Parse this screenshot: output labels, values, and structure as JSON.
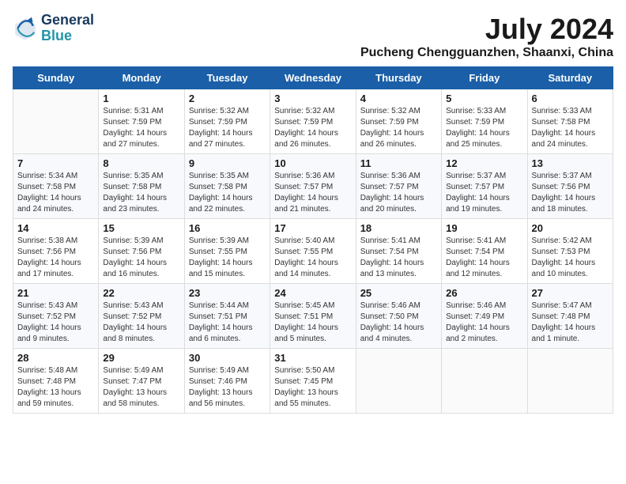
{
  "logo": {
    "line1": "General",
    "line2": "Blue"
  },
  "header": {
    "month_year": "July 2024",
    "location": "Pucheng Chengguanzhen, Shaanxi, China"
  },
  "weekdays": [
    "Sunday",
    "Monday",
    "Tuesday",
    "Wednesday",
    "Thursday",
    "Friday",
    "Saturday"
  ],
  "weeks": [
    [
      {
        "day": "",
        "sunrise": "",
        "sunset": "",
        "daylight": ""
      },
      {
        "day": "1",
        "sunrise": "Sunrise: 5:31 AM",
        "sunset": "Sunset: 7:59 PM",
        "daylight": "Daylight: 14 hours and 27 minutes."
      },
      {
        "day": "2",
        "sunrise": "Sunrise: 5:32 AM",
        "sunset": "Sunset: 7:59 PM",
        "daylight": "Daylight: 14 hours and 27 minutes."
      },
      {
        "day": "3",
        "sunrise": "Sunrise: 5:32 AM",
        "sunset": "Sunset: 7:59 PM",
        "daylight": "Daylight: 14 hours and 26 minutes."
      },
      {
        "day": "4",
        "sunrise": "Sunrise: 5:32 AM",
        "sunset": "Sunset: 7:59 PM",
        "daylight": "Daylight: 14 hours and 26 minutes."
      },
      {
        "day": "5",
        "sunrise": "Sunrise: 5:33 AM",
        "sunset": "Sunset: 7:59 PM",
        "daylight": "Daylight: 14 hours and 25 minutes."
      },
      {
        "day": "6",
        "sunrise": "Sunrise: 5:33 AM",
        "sunset": "Sunset: 7:58 PM",
        "daylight": "Daylight: 14 hours and 24 minutes."
      }
    ],
    [
      {
        "day": "7",
        "sunrise": "Sunrise: 5:34 AM",
        "sunset": "Sunset: 7:58 PM",
        "daylight": "Daylight: 14 hours and 24 minutes."
      },
      {
        "day": "8",
        "sunrise": "Sunrise: 5:35 AM",
        "sunset": "Sunset: 7:58 PM",
        "daylight": "Daylight: 14 hours and 23 minutes."
      },
      {
        "day": "9",
        "sunrise": "Sunrise: 5:35 AM",
        "sunset": "Sunset: 7:58 PM",
        "daylight": "Daylight: 14 hours and 22 minutes."
      },
      {
        "day": "10",
        "sunrise": "Sunrise: 5:36 AM",
        "sunset": "Sunset: 7:57 PM",
        "daylight": "Daylight: 14 hours and 21 minutes."
      },
      {
        "day": "11",
        "sunrise": "Sunrise: 5:36 AM",
        "sunset": "Sunset: 7:57 PM",
        "daylight": "Daylight: 14 hours and 20 minutes."
      },
      {
        "day": "12",
        "sunrise": "Sunrise: 5:37 AM",
        "sunset": "Sunset: 7:57 PM",
        "daylight": "Daylight: 14 hours and 19 minutes."
      },
      {
        "day": "13",
        "sunrise": "Sunrise: 5:37 AM",
        "sunset": "Sunset: 7:56 PM",
        "daylight": "Daylight: 14 hours and 18 minutes."
      }
    ],
    [
      {
        "day": "14",
        "sunrise": "Sunrise: 5:38 AM",
        "sunset": "Sunset: 7:56 PM",
        "daylight": "Daylight: 14 hours and 17 minutes."
      },
      {
        "day": "15",
        "sunrise": "Sunrise: 5:39 AM",
        "sunset": "Sunset: 7:56 PM",
        "daylight": "Daylight: 14 hours and 16 minutes."
      },
      {
        "day": "16",
        "sunrise": "Sunrise: 5:39 AM",
        "sunset": "Sunset: 7:55 PM",
        "daylight": "Daylight: 14 hours and 15 minutes."
      },
      {
        "day": "17",
        "sunrise": "Sunrise: 5:40 AM",
        "sunset": "Sunset: 7:55 PM",
        "daylight": "Daylight: 14 hours and 14 minutes."
      },
      {
        "day": "18",
        "sunrise": "Sunrise: 5:41 AM",
        "sunset": "Sunset: 7:54 PM",
        "daylight": "Daylight: 14 hours and 13 minutes."
      },
      {
        "day": "19",
        "sunrise": "Sunrise: 5:41 AM",
        "sunset": "Sunset: 7:54 PM",
        "daylight": "Daylight: 14 hours and 12 minutes."
      },
      {
        "day": "20",
        "sunrise": "Sunrise: 5:42 AM",
        "sunset": "Sunset: 7:53 PM",
        "daylight": "Daylight: 14 hours and 10 minutes."
      }
    ],
    [
      {
        "day": "21",
        "sunrise": "Sunrise: 5:43 AM",
        "sunset": "Sunset: 7:52 PM",
        "daylight": "Daylight: 14 hours and 9 minutes."
      },
      {
        "day": "22",
        "sunrise": "Sunrise: 5:43 AM",
        "sunset": "Sunset: 7:52 PM",
        "daylight": "Daylight: 14 hours and 8 minutes."
      },
      {
        "day": "23",
        "sunrise": "Sunrise: 5:44 AM",
        "sunset": "Sunset: 7:51 PM",
        "daylight": "Daylight: 14 hours and 6 minutes."
      },
      {
        "day": "24",
        "sunrise": "Sunrise: 5:45 AM",
        "sunset": "Sunset: 7:51 PM",
        "daylight": "Daylight: 14 hours and 5 minutes."
      },
      {
        "day": "25",
        "sunrise": "Sunrise: 5:46 AM",
        "sunset": "Sunset: 7:50 PM",
        "daylight": "Daylight: 14 hours and 4 minutes."
      },
      {
        "day": "26",
        "sunrise": "Sunrise: 5:46 AM",
        "sunset": "Sunset: 7:49 PM",
        "daylight": "Daylight: 14 hours and 2 minutes."
      },
      {
        "day": "27",
        "sunrise": "Sunrise: 5:47 AM",
        "sunset": "Sunset: 7:48 PM",
        "daylight": "Daylight: 14 hours and 1 minute."
      }
    ],
    [
      {
        "day": "28",
        "sunrise": "Sunrise: 5:48 AM",
        "sunset": "Sunset: 7:48 PM",
        "daylight": "Daylight: 13 hours and 59 minutes."
      },
      {
        "day": "29",
        "sunrise": "Sunrise: 5:49 AM",
        "sunset": "Sunset: 7:47 PM",
        "daylight": "Daylight: 13 hours and 58 minutes."
      },
      {
        "day": "30",
        "sunrise": "Sunrise: 5:49 AM",
        "sunset": "Sunset: 7:46 PM",
        "daylight": "Daylight: 13 hours and 56 minutes."
      },
      {
        "day": "31",
        "sunrise": "Sunrise: 5:50 AM",
        "sunset": "Sunset: 7:45 PM",
        "daylight": "Daylight: 13 hours and 55 minutes."
      },
      {
        "day": "",
        "sunrise": "",
        "sunset": "",
        "daylight": ""
      },
      {
        "day": "",
        "sunrise": "",
        "sunset": "",
        "daylight": ""
      },
      {
        "day": "",
        "sunrise": "",
        "sunset": "",
        "daylight": ""
      }
    ]
  ]
}
